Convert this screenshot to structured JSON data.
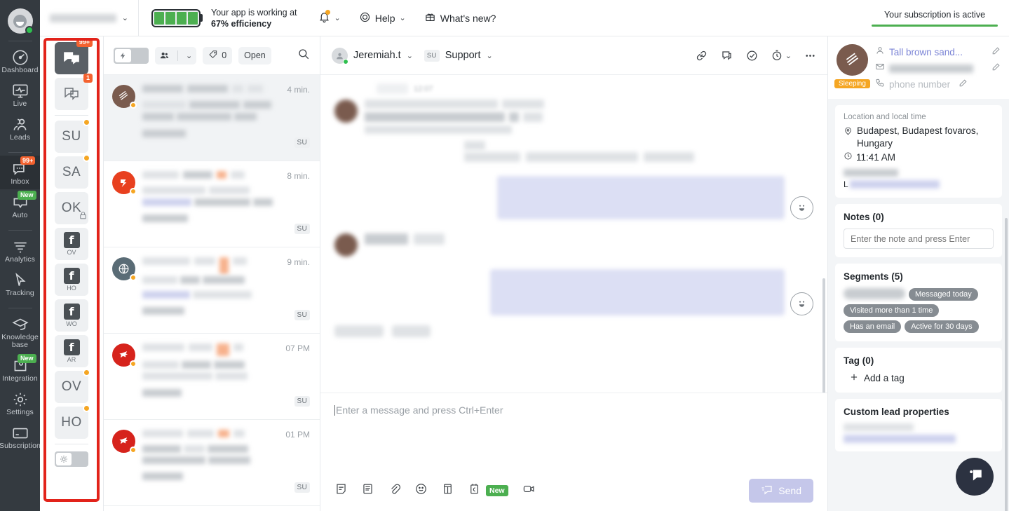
{
  "topbar": {
    "workspace_placeholder": "",
    "efficiency_line1": "Your app is working at",
    "efficiency_line2": "67% efficiency",
    "battery_cells_filled": 4,
    "battery_cells_total": 6,
    "help_label": "Help",
    "whats_new_label": "What's new?",
    "subscription_label": "Your subscription is active",
    "accent_green": "#4caf50"
  },
  "rail": {
    "items": [
      {
        "label": "Dashboard",
        "icon": "gauge-icon",
        "badge": "",
        "active": false
      },
      {
        "label": "Live",
        "icon": "monitor-pulse-icon",
        "badge": "",
        "active": false
      },
      {
        "label": "Leads",
        "icon": "people-icon",
        "badge": "",
        "active": false
      },
      {
        "label": "Inbox",
        "icon": "chat-icon",
        "badge": "99+",
        "active": true
      },
      {
        "label": "Auto",
        "icon": "automation-icon",
        "badge": "New",
        "active": false
      },
      {
        "label": "Analytics",
        "icon": "analytics-icon",
        "badge": "",
        "active": false
      },
      {
        "label": "Tracking",
        "icon": "cursor-icon",
        "badge": "",
        "active": false
      },
      {
        "label": "Knowledge base",
        "icon": "graduation-cap-icon",
        "badge": "",
        "active": false
      },
      {
        "label": "Integration",
        "icon": "puzzle-icon",
        "badge": "New",
        "active": false
      },
      {
        "label": "Settings",
        "icon": "gear-icon",
        "badge": "",
        "active": false
      },
      {
        "label": "Subscription",
        "icon": "credit-card-icon",
        "badge": "",
        "active": false
      }
    ]
  },
  "channels": {
    "highlight_color": "#e2231a",
    "items": [
      {
        "type": "chat",
        "label": "",
        "badge": "99+",
        "dot": false,
        "active": true
      },
      {
        "type": "chat-outline",
        "label": "",
        "badge": "1",
        "dot": false,
        "active": false
      },
      {
        "type": "initials",
        "label": "SU",
        "badge": "",
        "dot": true,
        "active": false
      },
      {
        "type": "initials",
        "label": "SA",
        "badge": "",
        "dot": true,
        "active": false
      },
      {
        "type": "initials",
        "label": "OK",
        "badge": "",
        "dot": false,
        "locked": true,
        "active": false
      },
      {
        "type": "facebook",
        "label": "OV",
        "badge": "",
        "dot": false,
        "active": false
      },
      {
        "type": "facebook",
        "label": "HO",
        "badge": "",
        "dot": false,
        "active": false
      },
      {
        "type": "facebook",
        "label": "WO",
        "badge": "",
        "dot": false,
        "active": false
      },
      {
        "type": "facebook",
        "label": "AR",
        "badge": "",
        "dot": false,
        "active": false
      },
      {
        "type": "initials",
        "label": "OV",
        "badge": "",
        "dot": true,
        "active": false
      },
      {
        "type": "initials",
        "label": "HO",
        "badge": "",
        "dot": true,
        "active": false
      }
    ],
    "theme_toggle_icon": "sun-icon"
  },
  "conversation_list": {
    "toolbar": {
      "lightning_toggle_icon": "lightning-icon",
      "assignee_icon": "people-icon",
      "tag_icon": "tag-icon",
      "tag_count": "0",
      "status_label": "Open",
      "search_icon": "search-icon"
    },
    "items": [
      {
        "time": "4 min.",
        "agent": "SU",
        "avatar_color": "#7a5b4e",
        "avatar_icon": "sandwich-icon",
        "selected": true
      },
      {
        "time": "8 min.",
        "agent": "SU",
        "avatar_color": "#e8401f",
        "avatar_icon": "brand-icon",
        "selected": false
      },
      {
        "time": "9 min.",
        "agent": "SU",
        "avatar_color": "#5a6c76",
        "avatar_icon": "globe-icon",
        "selected": false
      },
      {
        "time": "07 PM",
        "agent": "SU",
        "avatar_color": "#d6231c",
        "avatar_icon": "unicorn-icon",
        "selected": false
      },
      {
        "time": "01 PM",
        "agent": "SU",
        "avatar_color": "#d6231c",
        "avatar_icon": "unicorn-icon",
        "selected": false
      }
    ]
  },
  "chat": {
    "contact_name": "Jeremiah.t",
    "team_badge": "SU",
    "team_label": "Support",
    "actions": [
      {
        "icon": "link-icon"
      },
      {
        "icon": "comment-icon"
      },
      {
        "icon": "check-circle-icon"
      },
      {
        "icon": "timer-icon",
        "has_chevron": true
      },
      {
        "icon": "more-horizontal-icon"
      }
    ],
    "message_timestamp": "12:07",
    "composer": {
      "placeholder": "Enter a message and press Ctrl+Enter",
      "tools": [
        {
          "icon": "note-icon",
          "label": ""
        },
        {
          "icon": "canned-response-icon",
          "label": ""
        },
        {
          "icon": "attachment-icon",
          "label": ""
        },
        {
          "icon": "emoji-icon",
          "label": ""
        },
        {
          "icon": "article-icon",
          "label": ""
        },
        {
          "icon": "calendar-icon",
          "label": "New"
        },
        {
          "icon": "video-call-icon",
          "label": ""
        }
      ],
      "send_label": "Send",
      "send_icon": "send-message-icon"
    }
  },
  "right_panel": {
    "contact_name": "Tall brown sand...",
    "email_masked": "",
    "phone_placeholder": "phone number",
    "status_badge": "Sleeping",
    "location_card": {
      "title": "Location and local time",
      "location": "Budapest, Budapest fovaros, Hungary",
      "local_time": "11:41 AM",
      "extra_label": "L"
    },
    "notes": {
      "heading": "Notes (0)",
      "input_placeholder": "Enter the note and press Enter"
    },
    "segments": {
      "heading": "Segments (5)",
      "chips": [
        "",
        "Messaged today",
        "Visited more than 1 time",
        "Has an email",
        "Active for 30 days"
      ]
    },
    "tags": {
      "heading": "Tag (0)",
      "add_label": "Add a tag"
    },
    "custom_properties": {
      "heading": "Custom lead properties"
    }
  },
  "widget": {
    "icon": "chat-bubble-icon"
  }
}
